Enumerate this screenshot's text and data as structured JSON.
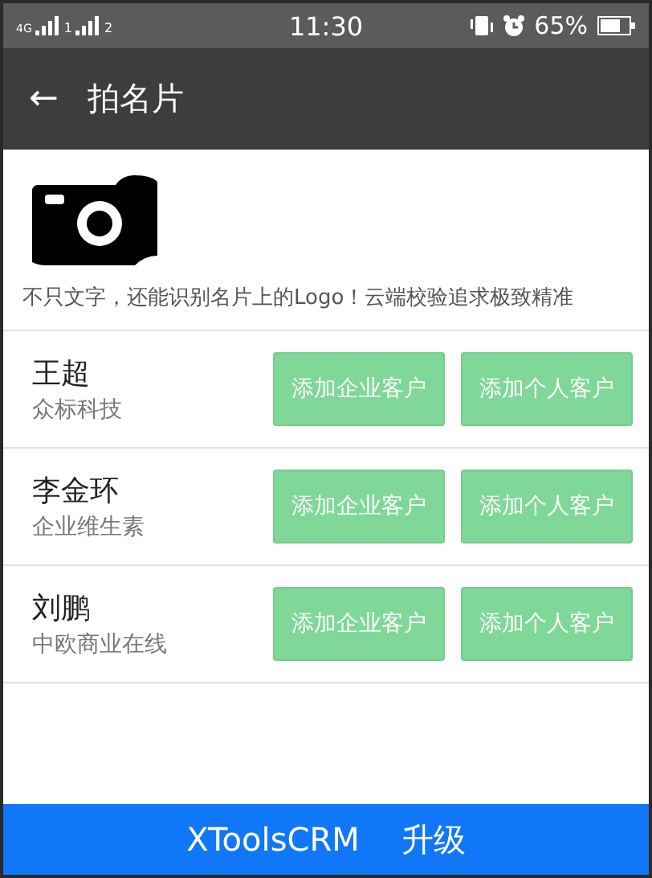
{
  "status_bar": {
    "network": "4G",
    "sim_1": "1",
    "sim_2": "2",
    "time": "11:30",
    "battery": "65%"
  },
  "header": {
    "back": "←",
    "title": "拍名片"
  },
  "intro": {
    "text": "不只文字，还能识别名片上的Logo！云端校验追求极致精准"
  },
  "contacts": [
    {
      "name": "王超",
      "company": "众标科技",
      "buttons": [
        "添加企业客户",
        "添加个人客户"
      ]
    },
    {
      "name": "李金环",
      "company": "企业维生素",
      "buttons": [
        "添加企业客户",
        "添加个人客户"
      ]
    },
    {
      "name": "刘鹏",
      "company": "中欧商业在线",
      "buttons": [
        "添加企业客户",
        "添加个人客户"
      ]
    }
  ],
  "footer": {
    "brand": "XToolsCRM",
    "action": "升级"
  }
}
